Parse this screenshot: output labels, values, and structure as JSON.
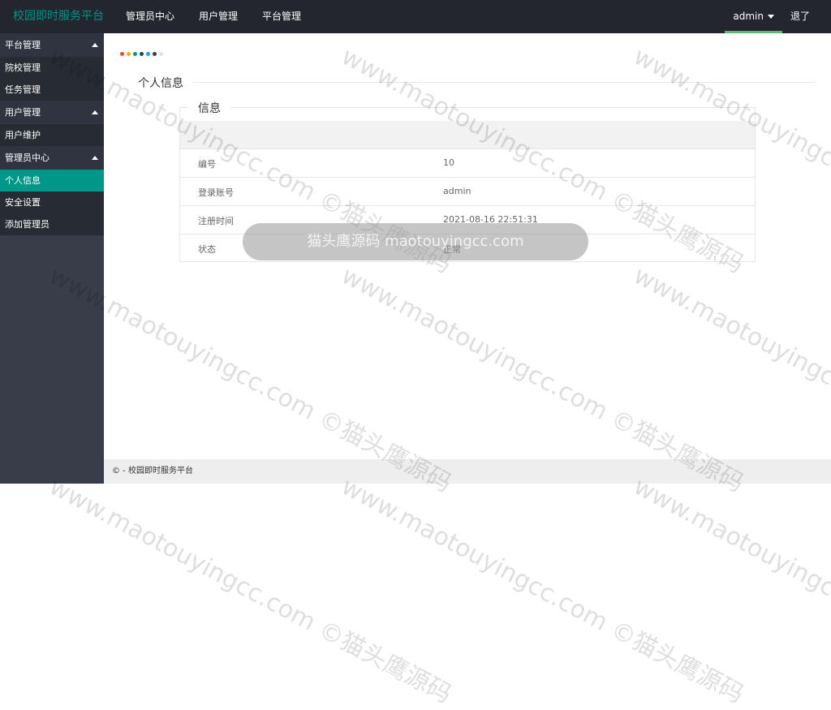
{
  "header": {
    "brand": "校园即时服务平台",
    "nav": [
      "管理员中心",
      "用户管理",
      "平台管理"
    ],
    "user": "admin",
    "logout": "退了"
  },
  "sidebar": {
    "groups": [
      {
        "title": "平台管理",
        "items": [
          "院校管理",
          "任务管理"
        ]
      },
      {
        "title": "用户管理",
        "items": [
          "用户维护"
        ]
      },
      {
        "title": "管理员中心",
        "items": [
          "个人信息",
          "安全设置",
          "添加管理员"
        ]
      }
    ],
    "active_item": "个人信息"
  },
  "main": {
    "dot_colors": [
      "#e04e3a",
      "#f0ad1c",
      "#009688",
      "#2f4056",
      "#1e9fff",
      "#393d49",
      "#e2e2e2"
    ],
    "section_title": "个人信息",
    "card_title": "信息",
    "rows": [
      {
        "key": "编号",
        "value": "10"
      },
      {
        "key": "登录账号",
        "value": "admin"
      },
      {
        "key": "注册时间",
        "value": "2021-08-16 22:51:31"
      },
      {
        "key": "状态",
        "value": "正常"
      }
    ]
  },
  "footer": {
    "text": "© - 校园即时服务平台"
  },
  "toast": {
    "text": "猫头鹰源码 maotouyingcc.com"
  },
  "watermark": {
    "text": "www.maotouyingcc.com ©猫头鹰源码"
  },
  "colors": {
    "topbar": "#23262e",
    "sidebar": "#393d49",
    "accent": "#009688",
    "user_bar": "#5fb878"
  }
}
